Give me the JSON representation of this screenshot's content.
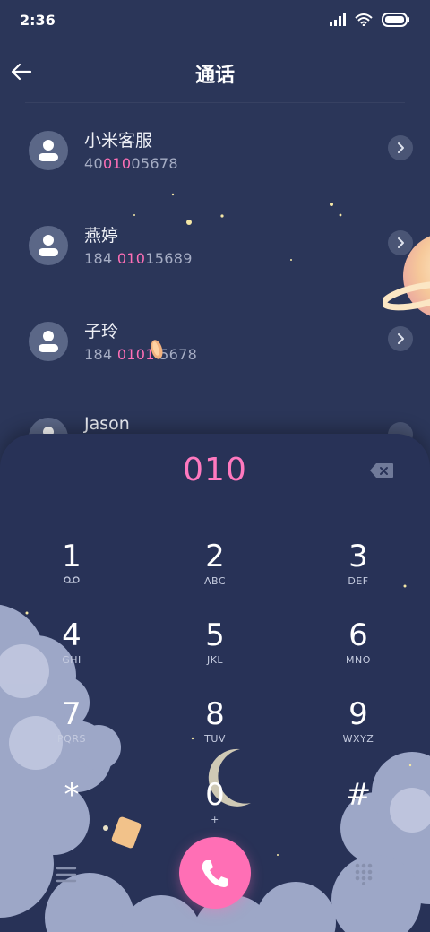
{
  "status_bar": {
    "time": "2:36"
  },
  "header": {
    "title": "通话"
  },
  "contacts": [
    {
      "name": "小米客服",
      "number_pre": "40",
      "number_hl": "010",
      "number_post": "05678"
    },
    {
      "name": "燕婷",
      "number_pre": "184 ",
      "number_hl": "010",
      "number_post": "15689"
    },
    {
      "name": "子玲",
      "number_pre": "184 ",
      "number_hl": "0101",
      "number_post": " 5678"
    },
    {
      "name": "Jason"
    }
  ],
  "dialer": {
    "display": "010",
    "keys": [
      {
        "digit": "1",
        "sub": ""
      },
      {
        "digit": "2",
        "sub": "ABC"
      },
      {
        "digit": "3",
        "sub": "DEF"
      },
      {
        "digit": "4",
        "sub": "GHI"
      },
      {
        "digit": "5",
        "sub": "JKL"
      },
      {
        "digit": "6",
        "sub": "MNO"
      },
      {
        "digit": "7",
        "sub": "PQRS"
      },
      {
        "digit": "8",
        "sub": "TUV"
      },
      {
        "digit": "9",
        "sub": "WXYZ"
      },
      {
        "digit": "*",
        "sub": ""
      },
      {
        "digit": "0",
        "sub": "+"
      },
      {
        "digit": "#",
        "sub": ""
      }
    ]
  },
  "icons": {
    "back": "back-arrow-icon",
    "avatar": "person-icon",
    "chevron": "chevron-right-icon",
    "backspace": "backspace-icon",
    "voicemail": "voicemail-icon",
    "call": "phone-icon",
    "menu": "menu-icon",
    "keypad": "keypad-icon"
  },
  "colors": {
    "background": "#2b3659",
    "panel": "#283257",
    "accent_pink": "#ff6fb6",
    "avatar": "#5b6787"
  }
}
